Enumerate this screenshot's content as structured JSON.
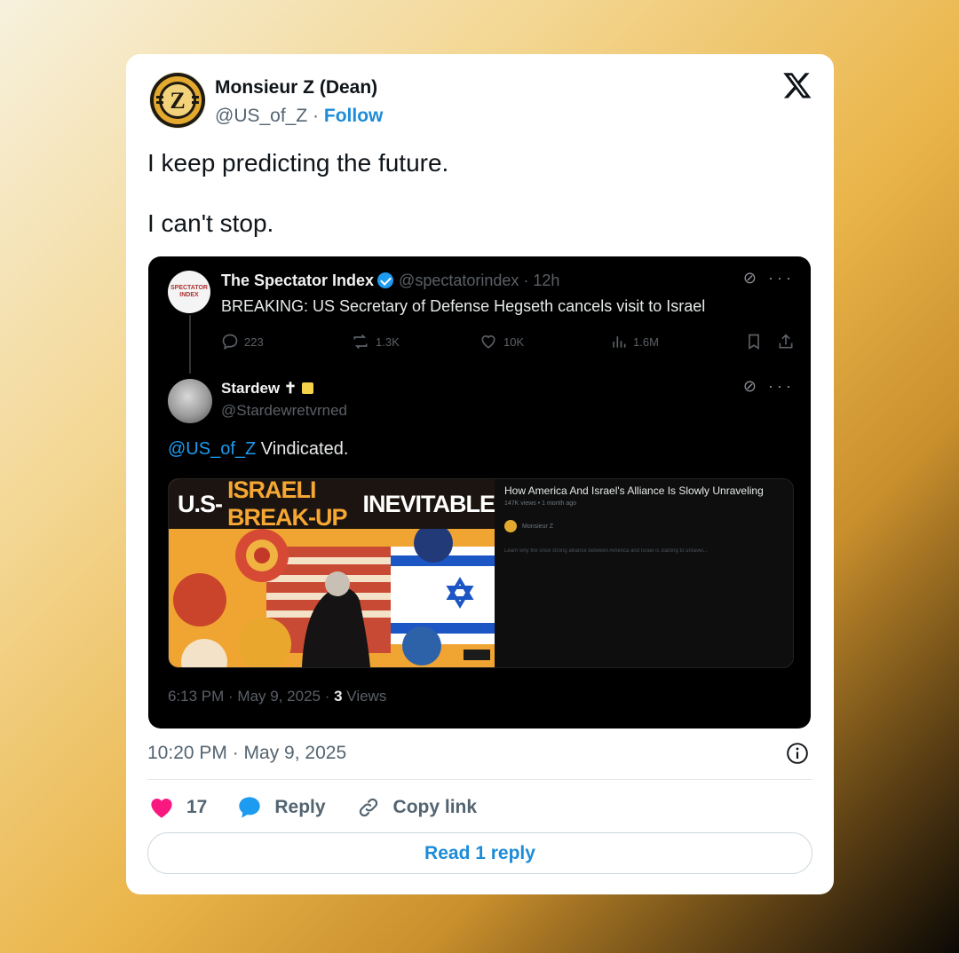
{
  "author": {
    "name": "Monsieur Z (Dean)",
    "handle": "@US_of_Z",
    "separator": "·",
    "follow_label": "Follow"
  },
  "tweet": {
    "paragraphs": [
      "I keep predicting the future.",
      "I can't stop."
    ]
  },
  "quoted": {
    "parent": {
      "name": "The Spectator Index",
      "meta": "@spectatorindex · 12h",
      "text": "BREAKING: US Secretary of Defense Hegseth cancels visit to Israel",
      "avatar_text": "SPECTATOR INDEX",
      "stats": {
        "replies": "223",
        "reposts": "1.3K",
        "likes": "10K",
        "views": "1.6M"
      }
    },
    "reply": {
      "name": "Stardew",
      "name_symbol": "✝",
      "handle": "@Stardewretvrned",
      "mention": "@US_of_Z",
      "text": "Vindicated."
    },
    "preview": {
      "thumb_title_a": "U.S-",
      "thumb_title_b": "ISRAELI BREAK-UP",
      "thumb_title_c": "INEVITABLE",
      "title": "How America And Israel's Alliance Is Slowly Unraveling",
      "sub": "147K views • 1 month ago",
      "author": "Monsieur Z",
      "description": "Learn why the once strong alliance between America and Israel is starting to unravel..."
    },
    "footer": {
      "time": "6:13 PM · May 9, 2025 · ",
      "views_count": "3",
      "views_label": " Views"
    }
  },
  "timestamp": "10:20 PM · May 9, 2025",
  "actions": {
    "likes": "17",
    "reply_label": "Reply",
    "copy_label": "Copy link"
  },
  "read_reply_label": "Read 1 reply",
  "colors": {
    "link": "#1d8cd8",
    "heart": "#f91880",
    "reply_bubble": "#1d9bf0"
  }
}
